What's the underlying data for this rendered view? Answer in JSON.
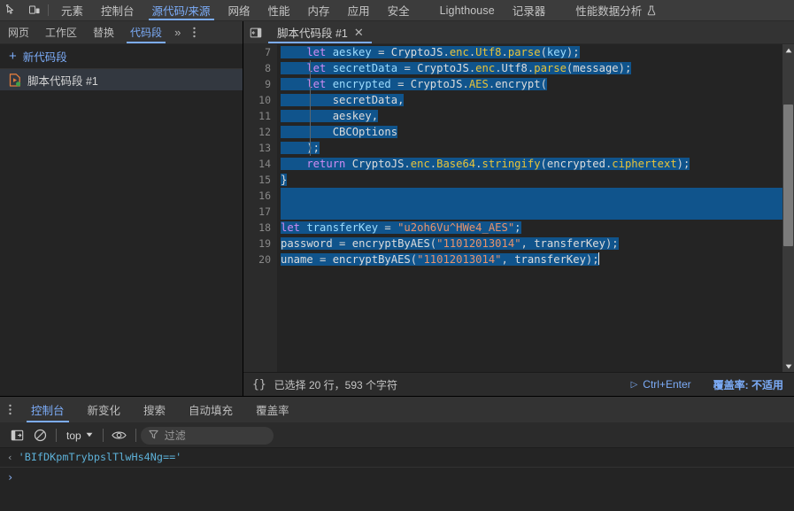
{
  "main_tabs": {
    "inspect_icon": "inspect-cursor-icon",
    "device_icon": "device-toggle-icon",
    "items": [
      {
        "label": "元素",
        "active": false
      },
      {
        "label": "控制台",
        "active": false
      },
      {
        "label": "源代码/来源",
        "active": true
      },
      {
        "label": "网络",
        "active": false
      },
      {
        "label": "性能",
        "active": false
      },
      {
        "label": "内存",
        "active": false
      },
      {
        "label": "应用",
        "active": false
      },
      {
        "label": "安全",
        "active": false
      },
      {
        "label": "Lighthouse",
        "active": false
      },
      {
        "label": "记录器",
        "active": false
      },
      {
        "label": "性能数据分析",
        "active": false
      }
    ],
    "recorder_flask_icon": "flask-icon"
  },
  "nav_pane": {
    "tabs": [
      {
        "label": "网页",
        "active": false
      },
      {
        "label": "工作区",
        "active": false
      },
      {
        "label": "替换",
        "active": false
      },
      {
        "label": "代码段",
        "active": true
      }
    ],
    "more_label": "»",
    "more_menu_icon": "kebab-menu-icon",
    "panel_toggle_icon": "collapse-sidebar-icon",
    "new_snippet": {
      "plus": "+",
      "label": "新代码段"
    },
    "snippets": [
      {
        "label": "脚本代码段 #1",
        "icon": "snippet-file-icon",
        "selected": true
      }
    ]
  },
  "editor": {
    "panel_toggle_icon": "show-navigator-icon",
    "tab": {
      "label": "脚本代码段 #1",
      "close": "✕"
    },
    "first_visible_line": 7,
    "lines": [
      {
        "n": 7,
        "text": "    let aeskey = CryptoJS.enc.Utf8.parse(key);"
      },
      {
        "n": 8,
        "text": "    let secretData = CryptoJS.enc.Utf8.parse(message);"
      },
      {
        "n": 9,
        "text": "    let encrypted = CryptoJS.AES.encrypt("
      },
      {
        "n": 10,
        "text": "        secretData,"
      },
      {
        "n": 11,
        "text": "        aeskey,"
      },
      {
        "n": 12,
        "text": "        CBCOptions"
      },
      {
        "n": 13,
        "text": "    );"
      },
      {
        "n": 14,
        "text": "    return CryptoJS.enc.Base64.stringify(encrypted.ciphertext);"
      },
      {
        "n": 15,
        "text": "}"
      },
      {
        "n": 16,
        "text": ""
      },
      {
        "n": 17,
        "text": ""
      },
      {
        "n": 18,
        "text": "let transferKey = \"u2oh6Vu^HWe4_AES\";"
      },
      {
        "n": 19,
        "text": "password = encryptByAES(\"11012013014\", transferKey);"
      },
      {
        "n": 20,
        "text": "uname = encryptByAES(\"11012013014\", transferKey);"
      }
    ],
    "scrollbar": {
      "up": "▲",
      "down": "▼"
    }
  },
  "status_bar": {
    "braces_icon": "{}",
    "selection_text": "已选择 20 行，593 个字符",
    "run_icon": "run-triangle-icon",
    "run_label": "Ctrl+Enter",
    "coverage_label": "覆盖率: 不适用"
  },
  "drawer": {
    "menu_icon": "kebab-menu-icon",
    "tabs": [
      {
        "label": "控制台",
        "active": true
      },
      {
        "label": "新变化",
        "active": false
      },
      {
        "label": "搜索",
        "active": false
      },
      {
        "label": "自动填充",
        "active": false
      },
      {
        "label": "覆盖率",
        "active": false
      }
    ],
    "toolbar": {
      "sidebar_icon": "console-sidebar-icon",
      "clear_icon": "clear-console-icon",
      "context_value": "top",
      "context_caret": "▼",
      "eye_icon": "live-expression-icon",
      "filter_icon": "filter-funnel-icon",
      "filter_placeholder": "过滤"
    },
    "messages": [
      {
        "marker": "‹",
        "kind": "result",
        "text": "'BIfDKpmTrybpslTlwHs4Ng=='"
      }
    ],
    "prompt_arrow": "›",
    "prompt_value": ""
  },
  "colors": {
    "accent": "#7cacf8",
    "selection": "#10548c",
    "toolbar_bg": "#3c3c3c",
    "panel_bg": "#242424",
    "tabbar_bg": "#333333",
    "string": "#e8926a",
    "keyword": "#cf8bf3",
    "property": "#e8c339",
    "variable": "#9cdcfe",
    "result_blue": "#5db0d7"
  }
}
